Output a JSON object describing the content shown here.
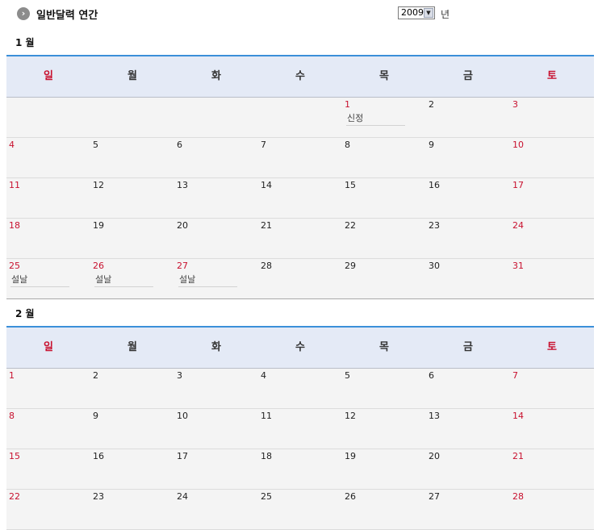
{
  "header": {
    "title": "일반달력 연간",
    "year_value": "2009",
    "year_suffix": "년"
  },
  "weekdays": [
    "일",
    "월",
    "화",
    "수",
    "목",
    "금",
    "토"
  ],
  "months": [
    {
      "title": "1 월",
      "weeks": [
        [
          null,
          null,
          null,
          null,
          {
            "day": "1",
            "holiday": "신정",
            "red": true
          },
          {
            "day": "2"
          },
          {
            "day": "3",
            "red": true
          }
        ],
        [
          {
            "day": "4",
            "red": true
          },
          {
            "day": "5"
          },
          {
            "day": "6"
          },
          {
            "day": "7"
          },
          {
            "day": "8"
          },
          {
            "day": "9"
          },
          {
            "day": "10",
            "red": true
          }
        ],
        [
          {
            "day": "11",
            "red": true
          },
          {
            "day": "12"
          },
          {
            "day": "13"
          },
          {
            "day": "14"
          },
          {
            "day": "15"
          },
          {
            "day": "16"
          },
          {
            "day": "17",
            "red": true
          }
        ],
        [
          {
            "day": "18",
            "red": true
          },
          {
            "day": "19"
          },
          {
            "day": "20"
          },
          {
            "day": "21"
          },
          {
            "day": "22"
          },
          {
            "day": "23"
          },
          {
            "day": "24",
            "red": true
          }
        ],
        [
          {
            "day": "25",
            "red": true,
            "holiday": "설날"
          },
          {
            "day": "26",
            "red": true,
            "holiday": "설날"
          },
          {
            "day": "27",
            "red": true,
            "holiday": "설날"
          },
          {
            "day": "28"
          },
          {
            "day": "29"
          },
          {
            "day": "30"
          },
          {
            "day": "31",
            "red": true
          }
        ]
      ]
    },
    {
      "title": "2 월",
      "weeks": [
        [
          {
            "day": "1",
            "red": true
          },
          {
            "day": "2"
          },
          {
            "day": "3"
          },
          {
            "day": "4"
          },
          {
            "day": "5"
          },
          {
            "day": "6"
          },
          {
            "day": "7",
            "red": true
          }
        ],
        [
          {
            "day": "8",
            "red": true
          },
          {
            "day": "9"
          },
          {
            "day": "10"
          },
          {
            "day": "11"
          },
          {
            "day": "12"
          },
          {
            "day": "13"
          },
          {
            "day": "14",
            "red": true
          }
        ],
        [
          {
            "day": "15",
            "red": true
          },
          {
            "day": "16"
          },
          {
            "day": "17"
          },
          {
            "day": "18"
          },
          {
            "day": "19"
          },
          {
            "day": "20"
          },
          {
            "day": "21",
            "red": true
          }
        ],
        [
          {
            "day": "22",
            "red": true
          },
          {
            "day": "23"
          },
          {
            "day": "24"
          },
          {
            "day": "25"
          },
          {
            "day": "26"
          },
          {
            "day": "27"
          },
          {
            "day": "28",
            "red": true
          }
        ]
      ]
    }
  ]
}
